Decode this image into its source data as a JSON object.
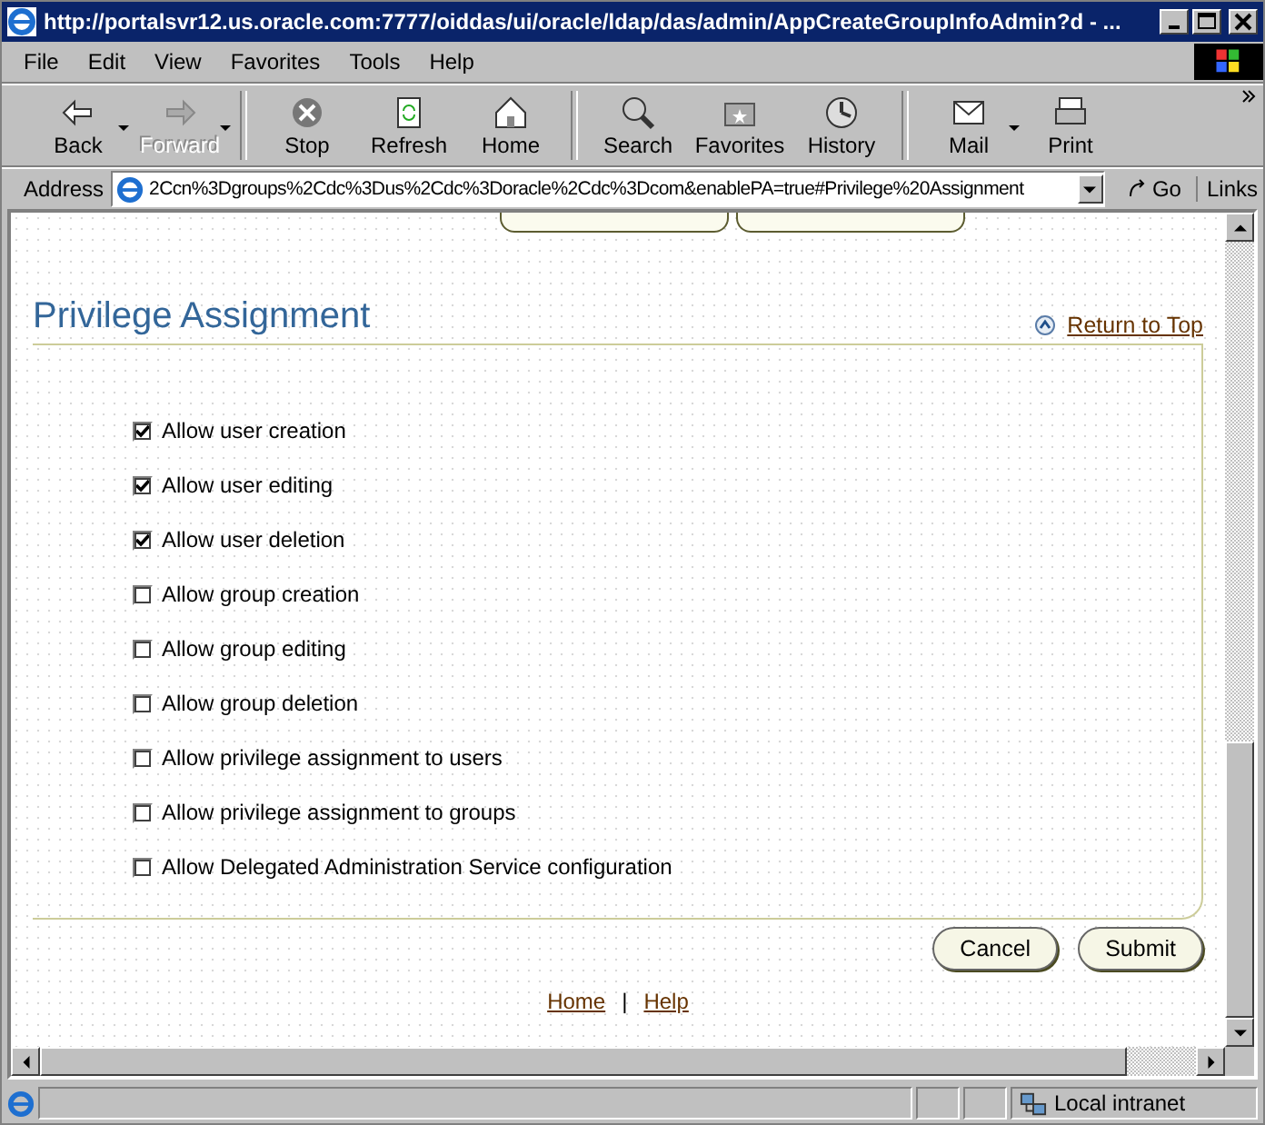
{
  "window": {
    "title": "http://portalsvr12.us.oracle.com:7777/oiddas/ui/oracle/ldap/das/admin/AppCreateGroupInfoAdmin?d - ..."
  },
  "menu": [
    "File",
    "Edit",
    "View",
    "Favorites",
    "Tools",
    "Help"
  ],
  "toolbar": [
    {
      "label": "Back",
      "disabled": false,
      "dropdown": true
    },
    {
      "label": "Forward",
      "disabled": true,
      "dropdown": true
    },
    {
      "label": "Stop",
      "disabled": false,
      "dropdown": false
    },
    {
      "label": "Refresh",
      "disabled": false,
      "dropdown": false
    },
    {
      "label": "Home",
      "disabled": false,
      "dropdown": false
    },
    {
      "label": "Search",
      "disabled": false,
      "dropdown": false
    },
    {
      "label": "Favorites",
      "disabled": false,
      "dropdown": false
    },
    {
      "label": "History",
      "disabled": false,
      "dropdown": false
    },
    {
      "label": "Mail",
      "disabled": false,
      "dropdown": true
    },
    {
      "label": "Print",
      "disabled": false,
      "dropdown": false
    }
  ],
  "address": {
    "label": "Address",
    "value": "2Ccn%3Dgroups%2Cdc%3Dus%2Cdc%3Doracle%2Cdc%3Dcom&enablePA=true#Privilege%20Assignment",
    "go": "Go",
    "links": "Links"
  },
  "section": {
    "title": "Privilege Assignment",
    "return_link": "Return to Top"
  },
  "privileges": [
    {
      "label": "Allow user creation",
      "checked": true
    },
    {
      "label": "Allow user editing",
      "checked": true
    },
    {
      "label": "Allow user deletion",
      "checked": true
    },
    {
      "label": "Allow group creation",
      "checked": false
    },
    {
      "label": "Allow group editing",
      "checked": false
    },
    {
      "label": "Allow group deletion",
      "checked": false
    },
    {
      "label": "Allow privilege assignment to users",
      "checked": false
    },
    {
      "label": "Allow privilege assignment to groups",
      "checked": false
    },
    {
      "label": "Allow Delegated Administration Service configuration",
      "checked": false
    }
  ],
  "buttons": [
    "Cancel",
    "Submit"
  ],
  "footer_links": [
    "Home",
    "Help"
  ],
  "footer_separator": "|",
  "status_bar": {
    "zone": "Local intranet"
  }
}
